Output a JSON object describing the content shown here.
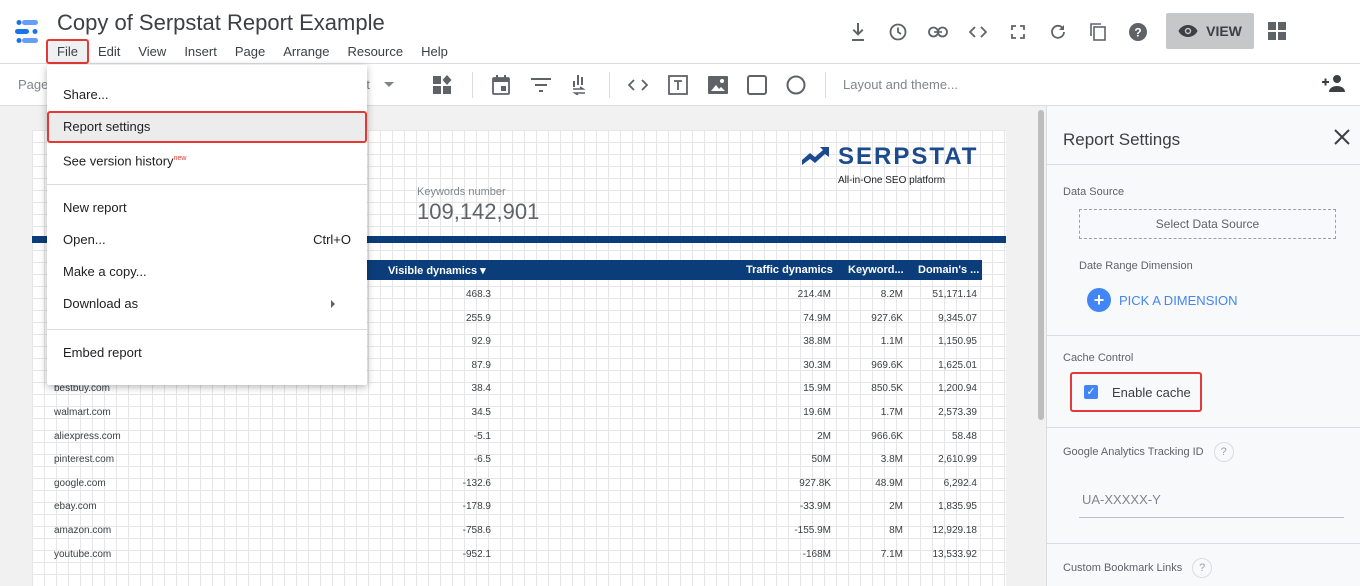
{
  "header": {
    "title": "Copy of Serpstat Report Example",
    "menu": [
      "File",
      "Edit",
      "View",
      "Insert",
      "Page",
      "Arrange",
      "Resource",
      "Help"
    ],
    "view_label": "VIEW",
    "icons": [
      "download-icon",
      "history-icon",
      "link-icon",
      "embed-code-icon",
      "fullscreen-icon",
      "refresh-icon",
      "copy-icon",
      "help-icon"
    ]
  },
  "toolbar": {
    "page_label": "Page",
    "rt_label": "rt",
    "layout_label": "Layout and theme..."
  },
  "file_menu": {
    "items": [
      {
        "label": "Share..."
      },
      {
        "label": "Report settings"
      },
      {
        "label": "See version history",
        "badge": "new"
      },
      {
        "label": "New report"
      },
      {
        "label": "Open...",
        "shortcut": "Ctrl+O"
      },
      {
        "label": "Make a copy..."
      },
      {
        "label": "Download as"
      },
      {
        "label": "Embed report"
      }
    ]
  },
  "report": {
    "brand_name": "SERPSTAT",
    "brand_tagline": "All-in-One SEO platform",
    "kw_label": "Keywords number",
    "kw_value": "109,142,901",
    "columns": [
      "Visible dynamics",
      "Traffic dynamics",
      "Keyword...",
      "Domain's ..."
    ],
    "rows": [
      {
        "domain": "",
        "visible": "468.3",
        "traffic": "214.4M",
        "keywords": "8.2M",
        "domain_val": "51,171.14"
      },
      {
        "domain": "",
        "visible": "255.9",
        "traffic": "74.9M",
        "keywords": "927.6K",
        "domain_val": "9,345.07"
      },
      {
        "domain": "",
        "visible": "92.9",
        "traffic": "38.8M",
        "keywords": "1.1M",
        "domain_val": "1,150.95"
      },
      {
        "domain": "",
        "visible": "87.9",
        "traffic": "30.3M",
        "keywords": "969.6K",
        "domain_val": "1,625.01"
      },
      {
        "domain": "bestbuy.com",
        "visible": "38.4",
        "traffic": "15.9M",
        "keywords": "850.5K",
        "domain_val": "1,200.94"
      },
      {
        "domain": "walmart.com",
        "visible": "34.5",
        "traffic": "19.6M",
        "keywords": "1.7M",
        "domain_val": "2,573.39"
      },
      {
        "domain": "aliexpress.com",
        "visible": "-5.1",
        "traffic": "2M",
        "keywords": "966.6K",
        "domain_val": "58.48"
      },
      {
        "domain": "pinterest.com",
        "visible": "-6.5",
        "traffic": "50M",
        "keywords": "3.8M",
        "domain_val": "2,610.99"
      },
      {
        "domain": "google.com",
        "visible": "-132.6",
        "traffic": "927.8K",
        "keywords": "48.9M",
        "domain_val": "6,292.4"
      },
      {
        "domain": "ebay.com",
        "visible": "-178.9",
        "traffic": "-33.9M",
        "keywords": "2M",
        "domain_val": "1,835.95"
      },
      {
        "domain": "amazon.com",
        "visible": "-758.6",
        "traffic": "-155.9M",
        "keywords": "8M",
        "domain_val": "12,929.18"
      },
      {
        "domain": "youtube.com",
        "visible": "-952.1",
        "traffic": "-168M",
        "keywords": "7.1M",
        "domain_val": "13,533.92"
      }
    ]
  },
  "settings_panel": {
    "title": "Report Settings",
    "data_source_label": "Data Source",
    "select_data_source": "Select Data Source",
    "date_range_label": "Date Range Dimension",
    "pick_dimension": "PICK A DIMENSION",
    "cache_control_label": "Cache Control",
    "enable_cache_label": "Enable cache",
    "enable_cache_checked": true,
    "ga_label": "Google Analytics Tracking ID",
    "ga_placeholder": "UA-XXXXX-Y",
    "bookmark_label": "Custom Bookmark Links"
  },
  "colors": {
    "brand_blue": "#0b3d7a",
    "accent_blue": "#4285f4",
    "highlight_red": "#e53935"
  }
}
